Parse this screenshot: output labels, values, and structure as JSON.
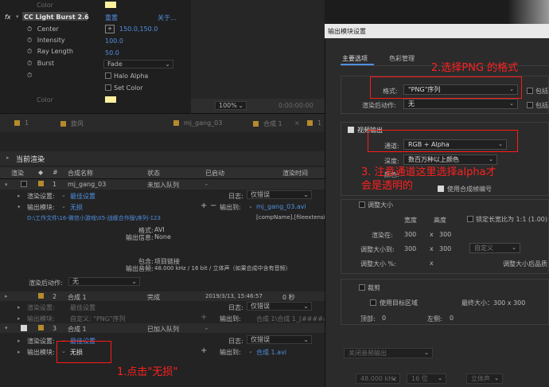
{
  "effects": {
    "color_top": "Color",
    "effect_name": "CC Light Burst 2.6",
    "reset": "重置",
    "about": "关于...",
    "rows": [
      {
        "label": "Center",
        "value": "150.0,150.0"
      },
      {
        "label": "Intensity",
        "value": "100.0"
      },
      {
        "label": "Ray Length",
        "value": "50.0"
      },
      {
        "label": "Burst",
        "value": "Fade"
      }
    ],
    "halo_alpha": "Halo Alpha",
    "set_color": "Set Color",
    "color_bottom": "Color",
    "fx_label": "fx",
    "accent": "#fff0a0"
  },
  "timeline": {
    "zoom": "100%",
    "timecode": "0:00:00:00"
  },
  "tabs": [
    {
      "num": "1",
      "label": ""
    },
    {
      "num": "",
      "label": "旋风"
    },
    {
      "num": "",
      "label": "mj_gang_03"
    },
    {
      "num": "",
      "label": "合成 1"
    },
    {
      "num": "1",
      "label": ""
    }
  ],
  "render_queue": {
    "title": "当前渲染",
    "columns": [
      "渲染",
      "#",
      "合成名称",
      "状态",
      "已启动",
      "渲染时间"
    ],
    "item1": {
      "num": "1",
      "name": "mj_gang_03",
      "status": "未加入队列",
      "started": "-",
      "render_settings_label": "渲染设置:",
      "render_settings_value": "最佳设置",
      "log_label": "日志:",
      "log_value": "仅错误",
      "output_module_label": "输出模块:",
      "output_module_value": "无损",
      "output_to_label": "输出到:",
      "output_to_value": "mj_gang_03.avi",
      "path": "D:\\工作文件\\16-微信小游戏\\05-战舰合作版\\序列-123",
      "comp_name": "[compName].[fileextension]",
      "format_label": "格式:",
      "format_value": "AVI",
      "output_info_label": "输出信息:",
      "output_info_value": "None",
      "embed_label": "包含:",
      "embed_value": "项目链接",
      "audio_label": "输出音频:",
      "audio_value": "48.000 kHz / 16 bit / 立体声（如果合成中含有音频）",
      "post_label": "渲染后动作:",
      "post_value": "无"
    },
    "item2": {
      "num": "2",
      "name": "合成 1",
      "status": "完成",
      "started": "2019/3/13, 15:46:57",
      "render_time": "0 秒",
      "render_settings_label": "渲染设置:",
      "render_settings_value": "最佳设置",
      "log_label": "日志:",
      "log_value": "仅错误",
      "output_module_label": "输出模块:",
      "output_module_value": "自定义: \"PNG\"序列",
      "output_to_label": "输出到:",
      "output_to_value": "合成 1\\合成 1_[#####]"
    },
    "item3": {
      "num": "3",
      "name": "合成 1",
      "status": "已加入队列",
      "started": "-",
      "render_settings_label": "渲染设置:",
      "render_settings_value": "最佳设置",
      "log_label": "日志:",
      "log_value": "仅错误",
      "output_module_label": "输出模块:",
      "output_module_value": "无损",
      "output_to_label": "输出到:",
      "output_to_value": "合成 1.avi"
    }
  },
  "dialog": {
    "title": "输出模块设置",
    "tabs": [
      "主要选项",
      "色彩管理"
    ],
    "format_label": "格式:",
    "format_value": "\"PNG\"序列",
    "include_label": "包括",
    "post_render_label": "渲染后动作:",
    "post_render_value": "无",
    "include_label2": "包括",
    "video_output_label": "视频输出",
    "channels_label": "通道:",
    "channels_value": "RGB + Alpha",
    "depth_label": "深度:",
    "depth_value": "数百万种以上颜色",
    "color_label": "颜色:",
    "use_comp_frame": "使用合成帧编号",
    "resize_label": "调整大小",
    "width_label": "宽度",
    "height_label": "高度",
    "lock_ratio": "锁定长宽比为 1:1 (1.00)",
    "render_at_label": "渲染在:",
    "render_at_w": "300",
    "render_at_h": "300",
    "resize_to_label": "调整大小到:",
    "resize_to_w": "300",
    "resize_to_h": "300",
    "custom": "自定义",
    "resize_pct_label": "调整大小 %:",
    "resize_quality": "调整大小后品质",
    "crop_label": "裁剪",
    "use_roi": "使用目标区域",
    "final_size": "最终大小：300 x 300",
    "top_label": "顶部:",
    "top_value": "0",
    "left_label": "左侧:",
    "left_value": "0",
    "audio_auto": "关闭音频输出",
    "audio_rate": "48.000 kHz",
    "audio_bits": "16 位",
    "audio_channels": "立体声"
  },
  "annotations": {
    "step1": "1.点击\"无损\"",
    "step2": "2.选择PNG 的格式",
    "step3_line1": "3. 注意通道这里选择alpha才",
    "step3_line2": "会是透明的",
    "color": "#ff2020"
  }
}
